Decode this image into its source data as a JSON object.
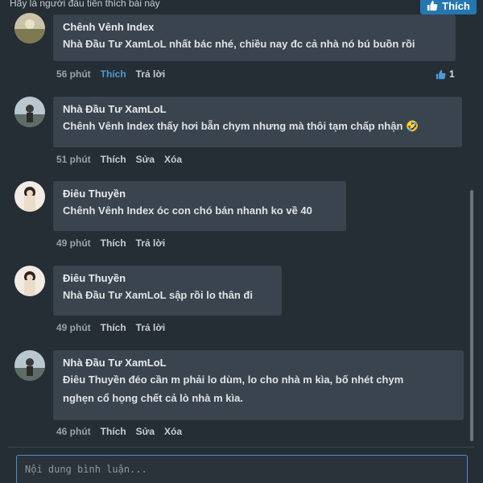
{
  "topbar": {
    "text": "Hãy là người đầu tiên thích bài này",
    "like_label": "Thích"
  },
  "comments": [
    {
      "author": "Chênh Vênh Index",
      "lines": [
        "Nhà Đầu Tư XamLoL nhất bác nhé, chiều nay đc cả nhà nó bú buồn rồi"
      ],
      "time": "56 phút",
      "actions": [
        "Thích",
        "Trả lời"
      ],
      "liked": true,
      "reaction_count": "1"
    },
    {
      "author": "Nhà Đầu Tư XamLoL",
      "lines": [
        "Chênh Vênh Index thấy hơi bẵn chym nhưng mà thôi tạm chấp nhận 🤣"
      ],
      "time": "51 phút",
      "actions": [
        "Thích",
        "Sửa",
        "Xóa"
      ]
    },
    {
      "author": "Điêu Thuyền",
      "lines": [
        "Chênh Vênh Index óc con chó bán nhanh ko về 40"
      ],
      "time": "49 phút",
      "actions": [
        "Thích",
        "Trả lời"
      ]
    },
    {
      "author": "Điêu Thuyền",
      "lines": [
        "Nhà Đầu Tư XamLoL sập rồi lo thân đi"
      ],
      "time": "49 phút",
      "actions": [
        "Thích",
        "Trả lời"
      ]
    },
    {
      "author": "Nhà Đầu Tư XamLoL",
      "lines": [
        "Điêu Thuyền đéo cần m phải lo dùm, lo cho nhà m kìa, bố nhét chym",
        "nghẹn cổ họng chết cả lò nhà m kìa."
      ],
      "time": "46 phút",
      "actions": [
        "Thích",
        "Sửa",
        "Xóa"
      ]
    }
  ],
  "input": {
    "placeholder": "Nội dung bình luận..."
  },
  "colors": {
    "background": "#252d35",
    "bubble": "#3a444e",
    "accent": "#2577b1",
    "liked": "#4d9bd6"
  }
}
